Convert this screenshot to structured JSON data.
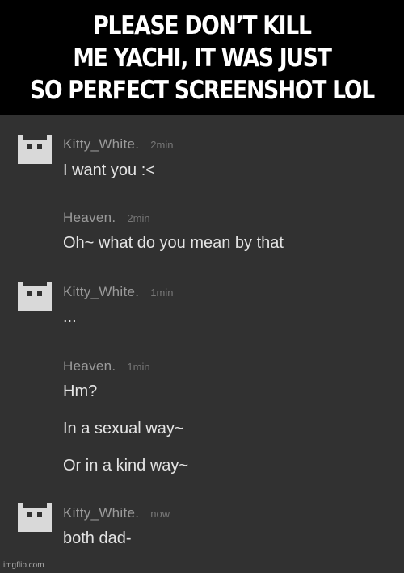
{
  "caption": {
    "line1": "PLEASE DON’T KILL",
    "line2": "ME YACHI, IT WAS JUST",
    "line3": "SO PERFECT SCREENSHOT LOL"
  },
  "colors": {
    "chat_background": "#313131",
    "caption_background": "#000000",
    "caption_text": "#ffffff",
    "username": "#9a9a9a",
    "timestamp": "#777777",
    "message_text": "#e4e4e4",
    "avatar": "#d9d9d9"
  },
  "messages": [
    {
      "avatar_icon": "pixel-cat-icon",
      "username": "Kitty_White.",
      "time": "2min",
      "lines": [
        "I want you :<"
      ]
    },
    {
      "username": "Heaven.",
      "time": "2min",
      "lines": [
        "Oh~ what do you mean by that"
      ]
    },
    {
      "avatar_icon": "pixel-cat-icon",
      "username": "Kitty_White.",
      "time": "1min",
      "lines": [
        "..."
      ]
    },
    {
      "username": "Heaven.",
      "time": "1min",
      "lines": [
        "Hm?",
        "In a sexual way~",
        "Or in a kind way~"
      ]
    },
    {
      "avatar_icon": "pixel-cat-icon",
      "username": "Kitty_White.",
      "time": "now",
      "lines": [
        "both dad-"
      ]
    }
  ],
  "watermark": "imgflip.com"
}
